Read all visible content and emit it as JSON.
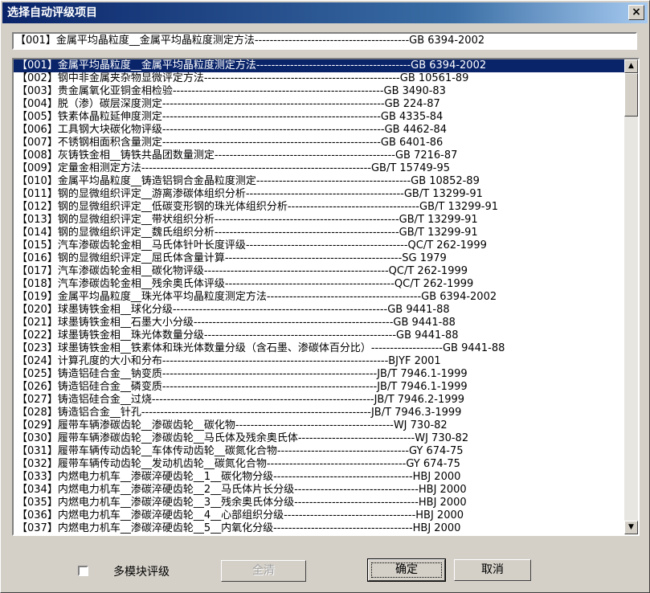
{
  "window": {
    "title": "选择自动评级项目",
    "close_symbol": "×"
  },
  "combo": {
    "selected_value": "【001】金属平均晶粒度__金属平均晶粒度测定方法-----------------------------------------GB 6394-2002"
  },
  "list": {
    "items": [
      {
        "label": "【001】金属平均晶粒度__金属平均晶粒度测定方法-----------------------------------------GB 6394-2002",
        "selected": true
      },
      {
        "label": "【002】钢中非金属夹杂物显微评定方法----------------------------------------------------GB 10561-89",
        "selected": false
      },
      {
        "label": "【003】贵金属氧化亚铜金相检验--------------------------------------------------------GB 3490-83",
        "selected": false
      },
      {
        "label": "【004】脱（渗）碳层深度测定-----------------------------------------------------------GB 224-87",
        "selected": false
      },
      {
        "label": "【005】铁素体晶粒延伸度测定----------------------------------------------------------GB 4335-84",
        "selected": false
      },
      {
        "label": "【006】工具钢大块碳化物评级-----------------------------------------------------------GB 4462-84",
        "selected": false
      },
      {
        "label": "【007】不锈钢相面积含量测定----------------------------------------------------------GB 6401-86",
        "selected": false
      },
      {
        "label": "【008】灰铸铁金相__铸铁共晶团数量测定------------------------------------------------GB 7216-87",
        "selected": false
      },
      {
        "label": "【009】定量金相测定方法-------------------------------------------------------------GB/T 15749-95",
        "selected": false
      },
      {
        "label": "【010】金属平均晶粒度__铸造铝铜合金晶粒度测定-----------------------------------------GB 10852-89",
        "selected": false
      },
      {
        "label": "【011】钢的显微组织评定__游离渗碳体组织分析------------------------------------------GB/T 13299-91",
        "selected": false
      },
      {
        "label": "【012】钢的显微组织评定__低碳变形钢的珠光体组织分析-----------------------------------GB/T 13299-91",
        "selected": false
      },
      {
        "label": "【013】钢的显微组织评定__带状组织分析-------------------------------------------------GB/T 13299-91",
        "selected": false
      },
      {
        "label": "【014】钢的显微组织评定__魏氏组织分析-------------------------------------------------GB/T 13299-91",
        "selected": false
      },
      {
        "label": "【015】汽车渗碳齿轮金相__马氏体针叶长度评级-------------------------------------------QC/T 262-1999",
        "selected": false
      },
      {
        "label": "【016】钢的显微组织评定__屈氏体含量计算-----------------------------------------------SG 1979",
        "selected": false
      },
      {
        "label": "【017】汽车渗碳齿轮金相__碳化物评级-------------------------------------------------QC/T 262-1999",
        "selected": false
      },
      {
        "label": "【018】汽车渗碳齿轮金相__残余奥氏体评级---------------------------------------------QC/T 262-1999",
        "selected": false
      },
      {
        "label": "【019】金属平均晶粒度__珠光体平均晶粒度测定方法-----------------------------------------GB 6394-2002",
        "selected": false
      },
      {
        "label": "【020】球墨铸铁金相__球化分级---------------------------------------------------------GB 9441-88",
        "selected": false
      },
      {
        "label": "【021】球墨铸铁金相__石墨大小分级-----------------------------------------------------GB 9441-88",
        "selected": false
      },
      {
        "label": "【022】球墨铸铁金相__珠光体数量分级---------------------------------------------------GB 9441-88",
        "selected": false
      },
      {
        "label": "【023】球墨铸铁金相__铁素体和珠光体数量分级（含石墨、渗碳体百分比）-------------------GB 9441-88",
        "selected": false
      },
      {
        "label": "【024】计算孔度的大小和分布------------------------------------------------------------BJYF 2001",
        "selected": false
      },
      {
        "label": "【025】铸造铝硅合金__钠变质---------------------------------------------------------JB/T 7946.1-1999",
        "selected": false
      },
      {
        "label": "【026】铸造铝硅合金__磷变质---------------------------------------------------------JB/T 7946.1-1999",
        "selected": false
      },
      {
        "label": "【027】铸造铝硅合金__过烧-----------------------------------------------------------JB/T 7946.2-1999",
        "selected": false
      },
      {
        "label": "【028】铸造铝合金__针孔-------------------------------------------------------------JB/T 7946.3-1999",
        "selected": false
      },
      {
        "label": "【029】履带车辆渗碳齿轮__渗碳齿轮__碳化物------------------------------------------WJ 730-82",
        "selected": false
      },
      {
        "label": "【030】履带车辆渗碳齿轮__渗碳齿轮__马氏体及残余奥氏体-------------------------------WJ 730-82",
        "selected": false
      },
      {
        "label": "【031】履带车辆传动齿轮__车体传动齿轮__碳氮化合物-----------------------------------GY 674-75",
        "selected": false
      },
      {
        "label": "【032】履带车辆传动齿轮__发动机齿轮__碳氮化合物-------------------------------------GY 674-75",
        "selected": false
      },
      {
        "label": "【033】内燃电力机车__渗碳淬硬齿轮__1__碳化物分级-------------------------------------HBJ 2000",
        "selected": false
      },
      {
        "label": "【034】内燃电力机车__渗碳淬硬齿轮__2__马氏体片长分级---------------------------------HBJ 2000",
        "selected": false
      },
      {
        "label": "【035】内燃电力机车__渗碳淬硬齿轮__3__残余奥氏体分级---------------------------------HBJ 2000",
        "selected": false
      },
      {
        "label": "【036】内燃电力机车__渗碳淬硬齿轮__4__心部组织分级-----------------------------------HBJ 2000",
        "selected": false
      },
      {
        "label": "【037】内燃电力机车__渗碳淬硬齿轮__5__内氧化分级-------------------------------------HBJ 2000",
        "selected": false
      }
    ]
  },
  "scrollbar": {
    "up_arrow": "▲",
    "down_arrow": "▼"
  },
  "footer": {
    "multi_module_label": "多模块评级",
    "clear_all_label": "全清",
    "ok_label": "确定",
    "cancel_label": "取消"
  }
}
